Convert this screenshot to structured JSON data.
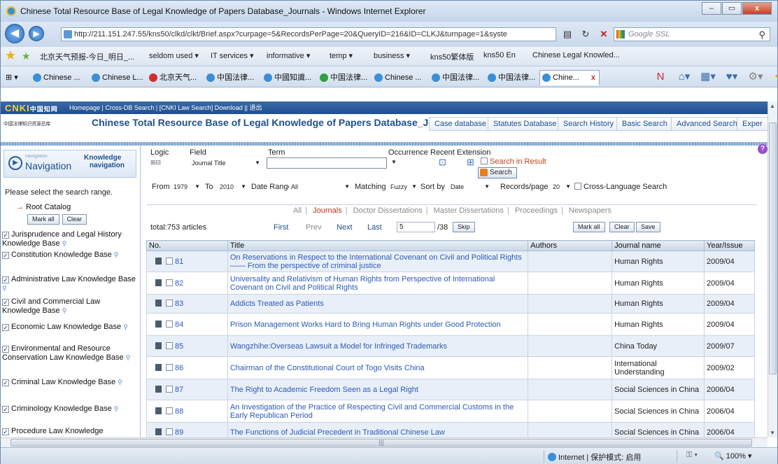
{
  "window": {
    "title": "Chinese Total Resource Base of Legal Knowledge of Papers Database_Journals - Windows Internet Explorer",
    "address": "http://211.151.247.55/kns50/clkd/clkt/Brief.aspx?curpage=5&RecordsPerPage=20&QueryID=216&ID=CLKJ&turnpage=1&syste",
    "search_placeholder": "Google SSL",
    "minimize": "–",
    "restore": "▭",
    "close": "x"
  },
  "favorites": [
    "北京天气预报-今日_明日_...",
    "seldom used ▾",
    "IT services ▾",
    "informative ▾",
    "temp ▾",
    "business ▾",
    "kns50繁体版",
    "kns50 En",
    "Chinese Legal Knowled..."
  ],
  "tabs": [
    "Chinese ...",
    "Chinese L...",
    "北京天气...",
    "中国法律...",
    "中國知識...",
    "中国法律...",
    "Chinese ...",
    "中国法律...",
    "中国法律...",
    "Chine..."
  ],
  "active_tab_close": "x",
  "site": {
    "logo_prefix": "CNKI",
    "logo_suffix": "中国知网",
    "nav_links": "Homepage | Cross-DB Search | [CNKI Law Search] Download || 退出",
    "subtitle": "中国法律知识资源总库",
    "title": "Chinese Total Resource Base of Legal Knowledge of Papers Database_Journals",
    "db_tabs": [
      "Case database",
      "Statutes Database",
      "Search History",
      "Basic Search",
      "Advanced Search",
      "Exper"
    ]
  },
  "sidebar": {
    "tiny": "navigation",
    "nav_word": "Navigation",
    "knowledge": "Knowledge",
    "knowledge2": "navigation",
    "prompt": "Please select the search range.",
    "root": "Root Catalog",
    "mark_all": "Mark all",
    "clear": "Clear",
    "items": [
      "Jurisprudence and Legal History Knowledge Base",
      "Constitution Knowledge Base",
      "Administrative Law Knowledge Base",
      "Civil and Commercial Law Knowledge Base",
      "Economic Law Knowledge Base",
      "Environmental and Resource Conservation Law Knowledge Base",
      "Criminal Law Knowledge Base",
      "Criminology Knowledge Base",
      "Procedure Law Knowledge"
    ]
  },
  "form": {
    "logic": "Logic",
    "field": "Field",
    "term": "Term",
    "occurrence": "Occurrence",
    "recent": "Recent",
    "extension": "Extension",
    "field_value": "Journal Title",
    "term_value": "",
    "search_in_result": "Search in Result",
    "search_btn": "Search",
    "from": "From",
    "from_value": "1979",
    "to": "To",
    "to_value": "2010",
    "date_range": "Date Range",
    "date_range_value": "All",
    "matching": "Matching",
    "matching_value": "Fuzzy",
    "sort_by": "Sort by",
    "sort_value": "Date",
    "records_page": "Records/page",
    "records_value": "20",
    "cross_lang": "Cross-Language Search",
    "help": "?"
  },
  "categories": {
    "all": "All",
    "journals": "Journals",
    "doctor": "Doctor Dissertations",
    "master": "Master Dissertations",
    "proceedings": "Proceedings",
    "newspapers": "Newspapers"
  },
  "pager": {
    "total": "total:753 articles",
    "first": "First",
    "prev": "Prev",
    "next": "Next",
    "last": "Last",
    "page": "5",
    "of": "/38",
    "skip": "Skip",
    "mark_all": "Mark all",
    "clear": "Clear",
    "save": "Save"
  },
  "table": {
    "headers": [
      "No.",
      "Title",
      "Authors",
      "Journal name",
      "Year/Issue"
    ],
    "rows": [
      {
        "no": "81",
        "title": "On Reservations in Respect to the International Covenant on Civil and Political Rights—— From the perspective of criminal justice",
        "authors": "",
        "journal": "Human Rights",
        "year": "2009/04"
      },
      {
        "no": "82",
        "title": "Universality and Relativism of Human Rights from Perspective of International Covenant on Civil and Political Rights",
        "authors": "",
        "journal": "Human Rights",
        "year": "2009/04"
      },
      {
        "no": "83",
        "title": "Addicts Treated as Patients",
        "authors": "",
        "journal": "Human Rights",
        "year": "2009/04"
      },
      {
        "no": "84",
        "title": "Prison Management Works Hard to Bring Human Rights under Good Protection",
        "authors": "",
        "journal": "Human Rights",
        "year": "2009/04"
      },
      {
        "no": "85",
        "title": "Wangzhihe:Overseas Lawsuit a Model for Infringed Trademarks",
        "authors": "",
        "journal": "China Today",
        "year": "2009/07"
      },
      {
        "no": "86",
        "title": "Chairman of the Constitutional Court of Togo Visits China",
        "authors": "",
        "journal": "International Understanding",
        "year": "2009/02"
      },
      {
        "no": "87",
        "title": "The Right to Academic Freedom Seen as a Legal Right",
        "authors": "",
        "journal": "Social Sciences in China",
        "year": "2006/04"
      },
      {
        "no": "88",
        "title": "An Investigation of the Practice of Respecting Civil and Commercial Customs in the Early Republican Period",
        "authors": "",
        "journal": "Social Sciences in China",
        "year": "2006/04"
      },
      {
        "no": "89",
        "title": "The Functions of Judicial Precedent in Traditional Chinese Law",
        "authors": "",
        "journal": "Social Sciences in China",
        "year": "2006/04"
      }
    ]
  },
  "status": {
    "zone": "Internet | 保护模式: 启用",
    "zoom": "100%"
  }
}
